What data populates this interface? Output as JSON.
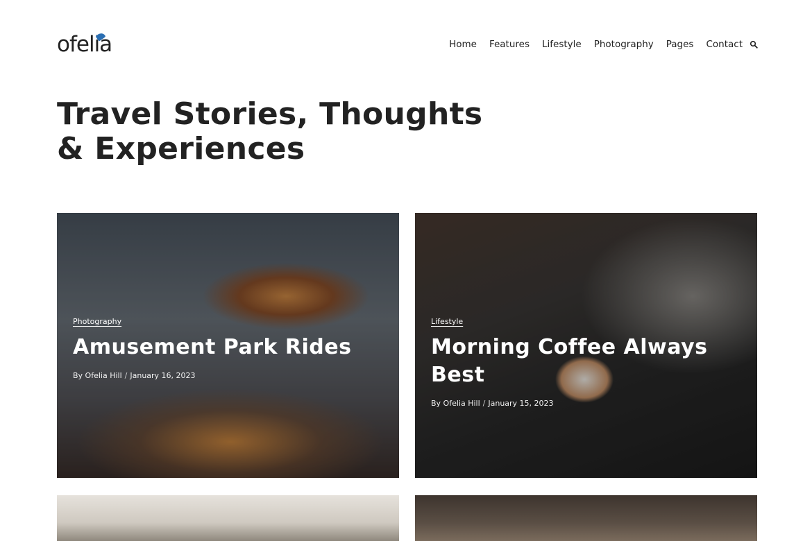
{
  "header": {
    "logo": "ofelia",
    "nav": [
      "Home",
      "Features",
      "Lifestyle",
      "Photography",
      "Pages",
      "Contact"
    ]
  },
  "page": {
    "title": "Travel Stories, Thoughts & Experiences"
  },
  "posts": [
    {
      "category": "Photography",
      "title": "Amusement Park Rides",
      "author": "By Ofelia Hill",
      "date": "January 16, 2023"
    },
    {
      "category": "Lifestyle",
      "title": "Morning Coffee Always Best",
      "author": "By Ofelia Hill",
      "date": "January 15, 2023"
    }
  ],
  "colors": {
    "text": "#222222",
    "logo_accent": "#2b6fb3",
    "background": "#ffffff"
  },
  "icons": {
    "search": "search-icon"
  }
}
